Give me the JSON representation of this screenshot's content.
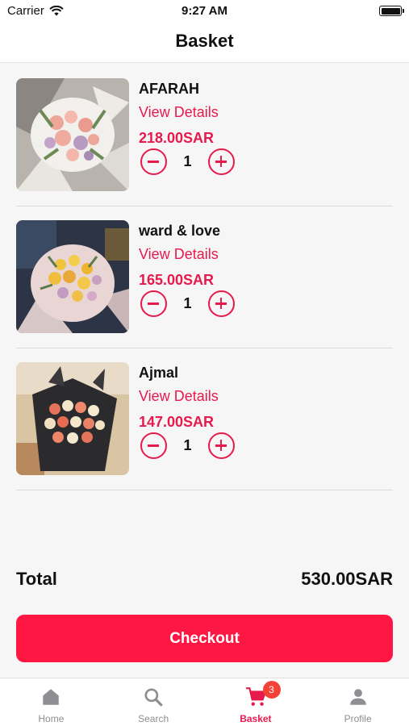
{
  "status_bar": {
    "carrier": "Carrier",
    "time": "9:27 AM"
  },
  "header": {
    "title": "Basket"
  },
  "items": [
    {
      "name": "AFARAH",
      "details_link": "View Details",
      "price": "218.00SAR",
      "quantity": "1"
    },
    {
      "name": "ward & love",
      "details_link": "View Details",
      "price": "165.00SAR",
      "quantity": "1"
    },
    {
      "name": "Ajmal",
      "details_link": "View Details",
      "price": "147.00SAR",
      "quantity": "1"
    }
  ],
  "summary": {
    "total_label": "Total",
    "total_value": "530.00SAR"
  },
  "checkout": {
    "label": "Checkout"
  },
  "tabs": [
    {
      "label": "Home",
      "icon": "home-icon"
    },
    {
      "label": "Search",
      "icon": "search-icon"
    },
    {
      "label": "Basket",
      "icon": "cart-icon",
      "badge": "3",
      "active": true
    },
    {
      "label": "Profile",
      "icon": "person-icon"
    }
  ],
  "colors": {
    "accent": "#e8194b",
    "checkout": "#ff1744",
    "badge": "#f44336",
    "inactive_tab": "#8e8e93"
  }
}
